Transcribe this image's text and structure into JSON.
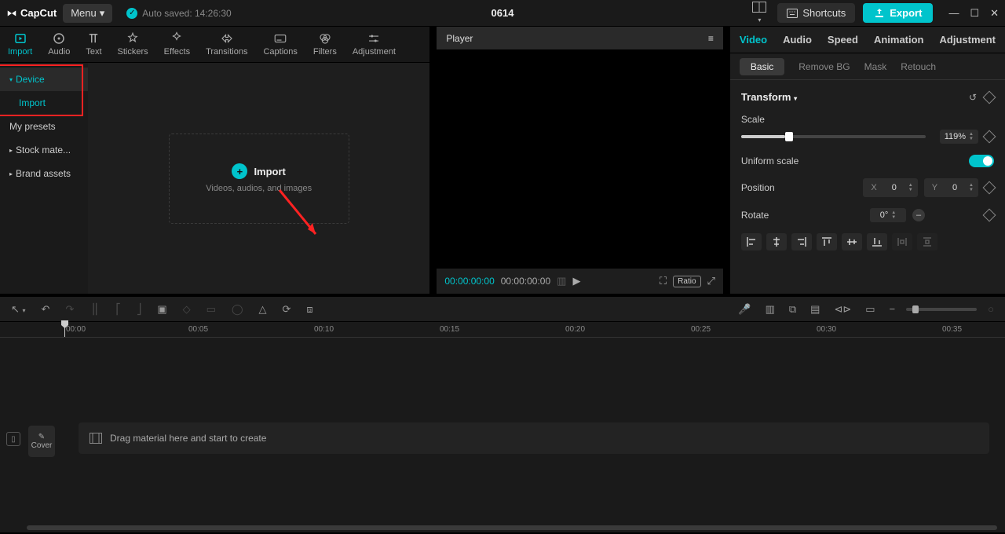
{
  "titlebar": {
    "app": "CapCut",
    "menu": "Menu",
    "autosave": "Auto saved: 14:26:30",
    "project": "0614",
    "shortcuts": "Shortcuts",
    "export": "Export"
  },
  "media_tabs": [
    "Import",
    "Audio",
    "Text",
    "Stickers",
    "Effects",
    "Transitions",
    "Captions",
    "Filters",
    "Adjustment"
  ],
  "media_active_tab": 0,
  "media_side": {
    "device": "Device",
    "import": "Import",
    "presets": "My presets",
    "stock": "Stock mate...",
    "brand": "Brand assets"
  },
  "import_zone": {
    "label": "Import",
    "sub": "Videos, audios, and images"
  },
  "player": {
    "title": "Player",
    "tc_current": "00:00:00:00",
    "tc_total": "00:00:00:00",
    "ratio": "Ratio"
  },
  "inspector": {
    "tabs": [
      "Video",
      "Audio",
      "Speed",
      "Animation",
      "Adjustment"
    ],
    "subtabs": [
      "Basic",
      "Remove BG",
      "Mask",
      "Retouch"
    ],
    "transform": "Transform",
    "scale": {
      "label": "Scale",
      "value": "119%",
      "pct": 24
    },
    "uniform": "Uniform scale",
    "position": {
      "label": "Position",
      "x": "0",
      "y": "0"
    },
    "rotate": {
      "label": "Rotate",
      "value": "0°"
    }
  },
  "timeline": {
    "cover": "Cover",
    "drop_hint": "Drag material here and start to create",
    "ticks": [
      "00:00",
      "00:05",
      "00:10",
      "00:15",
      "00:20",
      "00:25",
      "00:30",
      "00:35"
    ]
  }
}
